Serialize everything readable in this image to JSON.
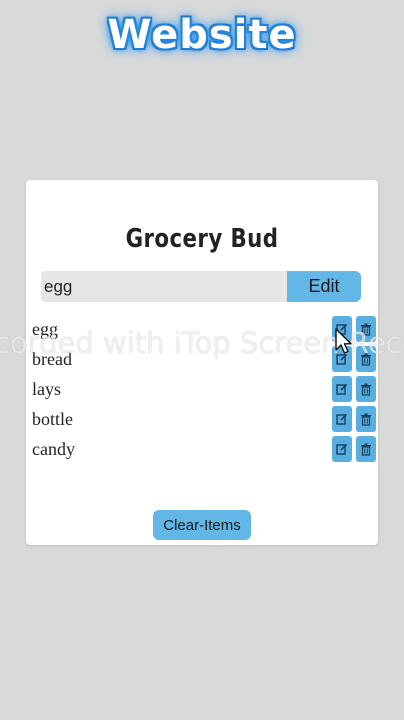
{
  "overlay": {
    "title": "Website",
    "watermark": "corded with iTop Screen Recor"
  },
  "app": {
    "title": "Grocery Bud",
    "input_value": "egg",
    "edit_label": "Edit",
    "clear_label": "Clear-Items",
    "items": [
      {
        "name": "egg"
      },
      {
        "name": "bread"
      },
      {
        "name": "lays"
      },
      {
        "name": "bottle"
      },
      {
        "name": "candy"
      }
    ]
  },
  "icons": {
    "edit": "edit-icon",
    "delete": "trash-icon"
  },
  "colors": {
    "accent": "#63b7e6",
    "icon_button": "#58aee0",
    "background": "#d9d9d9",
    "card": "#ffffff"
  }
}
